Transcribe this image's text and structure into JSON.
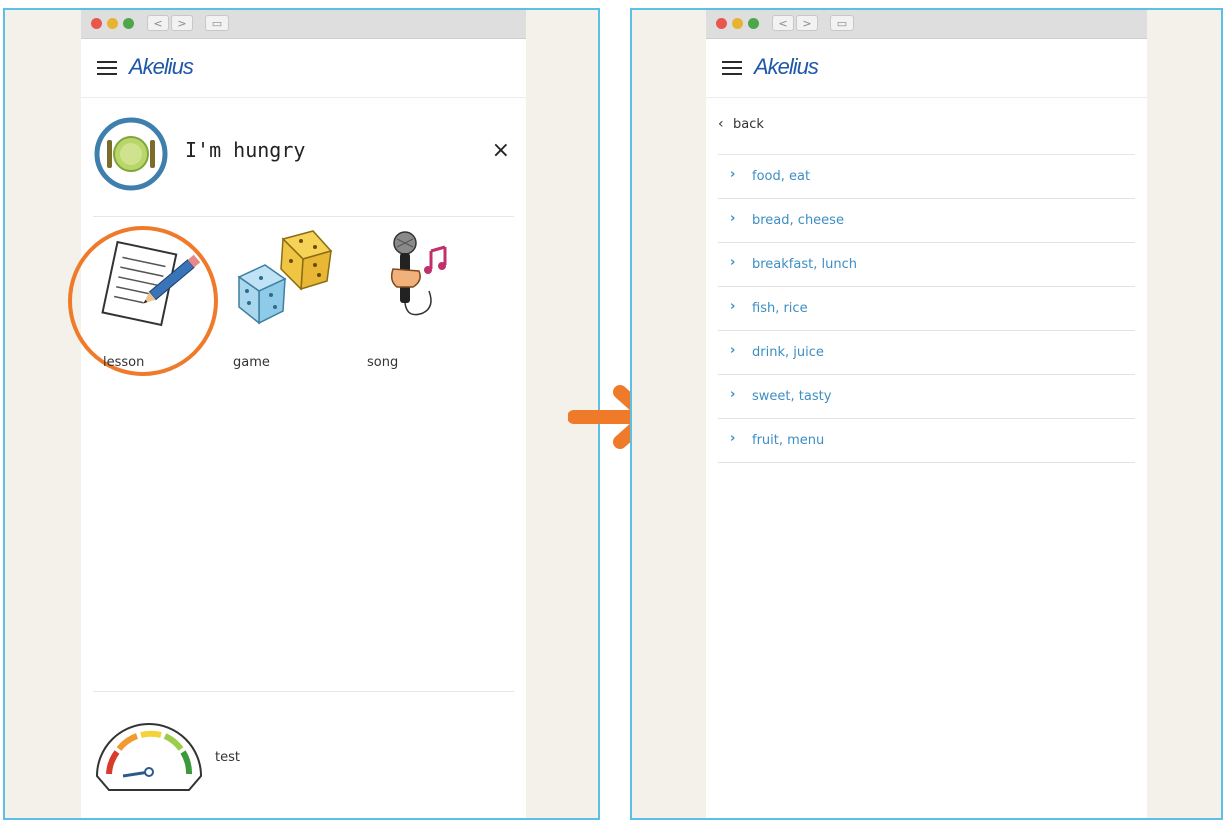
{
  "left_panel": {
    "app_logo": "Akelius",
    "topic_title": "I'm hungry",
    "close_glyph": "×",
    "activities": [
      {
        "label": "lesson",
        "icon": "lesson-paper-pencil-icon",
        "highlighted": true
      },
      {
        "label": "game",
        "icon": "dice-icon",
        "highlighted": false
      },
      {
        "label": "song",
        "icon": "microphone-music-icon",
        "highlighted": false
      }
    ],
    "footer": {
      "label": "test",
      "icon": "gauge-icon"
    }
  },
  "right_panel": {
    "app_logo": "Akelius",
    "back_glyph": "‹",
    "back_label": "back",
    "items": [
      {
        "chevron": "›",
        "label": "food, eat"
      },
      {
        "chevron": "›",
        "label": "bread, cheese"
      },
      {
        "chevron": "›",
        "label": "breakfast, lunch"
      },
      {
        "chevron": "›",
        "label": "fish, rice"
      },
      {
        "chevron": "›",
        "label": "drink, juice"
      },
      {
        "chevron": "›",
        "label": "sweet, tasty"
      },
      {
        "chevron": "›",
        "label": "fruit, menu"
      }
    ]
  },
  "colors": {
    "frame_border": "#5bbfe6",
    "highlight_circle": "#ef7a2a",
    "arrow": "#ef7a2a",
    "logo": "#1e58a8",
    "link": "#3d8ec4"
  }
}
